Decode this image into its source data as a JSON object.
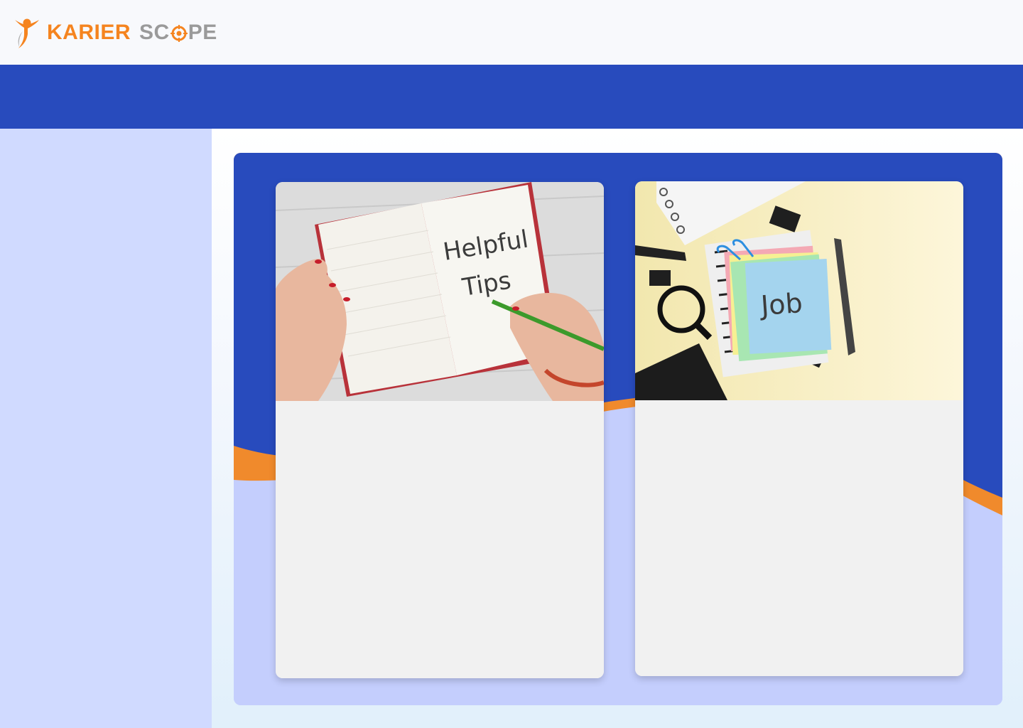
{
  "header": {
    "logo": {
      "word1": "KARIER",
      "word2_prefix": "SC",
      "word2_suffix": "PE",
      "icon": "person-target-logo-icon",
      "colors": {
        "orange": "#f5841f",
        "gray": "#9a9a9a"
      }
    }
  },
  "banner": {
    "color": "#284bbd"
  },
  "sidebar": {
    "color": "#d0daff"
  },
  "cards": [
    {
      "image_text_line1": "Helpful",
      "image_text_line2": "Tips",
      "image": "notebook-helpful-tips-photo"
    },
    {
      "image_text": "Job",
      "image": "desk-sticky-note-job-photo"
    }
  ],
  "colors": {
    "accent_blue": "#284bbd",
    "accent_orange": "#f08a2c",
    "panel_light": "#c4cefd",
    "card_bg": "#f1f1f1"
  }
}
